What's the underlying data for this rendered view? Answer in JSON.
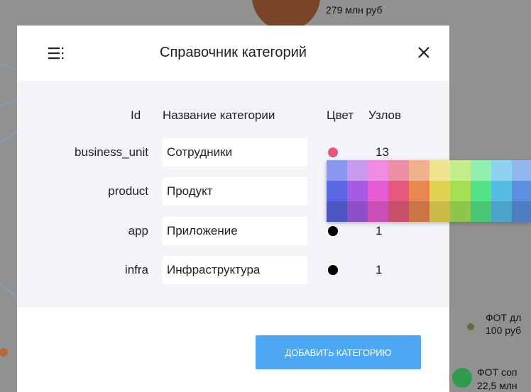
{
  "background": {
    "top_label": "279 млн руб",
    "legend_item_1_line1": "ФОТ дл",
    "legend_item_1_line2": "100 руб",
    "legend_item_2_line1": "ФОТ соп",
    "legend_item_2_line2": "22,5 млн"
  },
  "dialog": {
    "title": "Справочник категорий",
    "menu_icon": "hamburger-menu-icon",
    "close_icon": "close-icon",
    "columns": {
      "id": "Id",
      "name": "Название категории",
      "color": "Цвет",
      "nodes": "Узлов"
    },
    "rows": [
      {
        "id": "business_unit",
        "name": "Сотрудники",
        "color": "#e2587a",
        "count": "13"
      },
      {
        "id": "product",
        "name": "Продукт",
        "color": "#000000",
        "count": ""
      },
      {
        "id": "app",
        "name": "Приложение",
        "color": "#000000",
        "count": "1"
      },
      {
        "id": "infra",
        "name": "Инфраструктура",
        "color": "#000000",
        "count": "1"
      }
    ],
    "add_button": "ДОБАВИТЬ КАТЕГОРИЮ"
  },
  "palette": {
    "colors": [
      [
        "#8a97ef",
        "#c79af0",
        "#ef8be3",
        "#ef8fa7",
        "#f1b18c",
        "#efe38f",
        "#c3ec8a",
        "#90eeae",
        "#8dd3f0",
        "#8fb6ee"
      ],
      [
        "#5b67e3",
        "#a55be3",
        "#e35cd1",
        "#e3587c",
        "#e8874f",
        "#e3d24f",
        "#a6df55",
        "#55e389",
        "#55bde3",
        "#5d8fe0"
      ],
      [
        "#4f56c4",
        "#8f4fc8",
        "#c84fb5",
        "#c84f6a",
        "#cb7546",
        "#cbbb46",
        "#8dc64a",
        "#4ac677",
        "#4aa5c8",
        "#4f7dc4"
      ]
    ]
  }
}
